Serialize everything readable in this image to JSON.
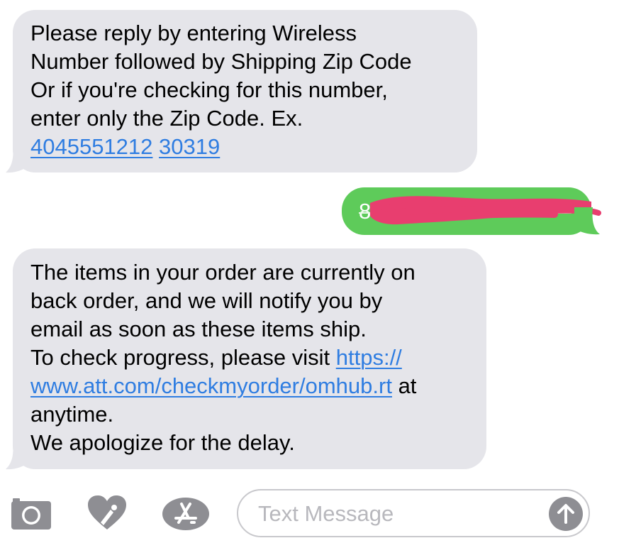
{
  "thread": {
    "messages": [
      {
        "direction": "incoming",
        "lines": [
          "Please reply by entering Wireless",
          "Number followed by Shipping Zip Code",
          "Or if you're checking for this number,",
          "enter only the Zip Code. Ex."
        ],
        "links": [
          "4045551212",
          "30319"
        ]
      },
      {
        "direction": "outgoing",
        "text_visible": "8",
        "redacted": true
      },
      {
        "direction": "incoming",
        "lines": [
          "The items in your order are currently on",
          "back order, and we will notify you by",
          "email as soon as these items ship.",
          "To check progress, please visit "
        ],
        "link_part1": "https://",
        "link_part2": "www.att.com/checkmyorder/omhub.rt",
        "after_link": " at",
        "line_anytime": "anytime.",
        "line_apology": "We apologize for the delay."
      }
    ]
  },
  "composer": {
    "camera_icon": "camera-icon",
    "digital_touch_icon": "digital-touch-heart-icon",
    "app_store_icon": "app-store-icon",
    "placeholder": "Text Message",
    "send_icon": "send-arrow-icon"
  },
  "colors": {
    "incoming_bubble": "#e5e5ea",
    "outgoing_bubble": "#5ecb5a",
    "link": "#2f7de1",
    "redaction": "#e83e6f",
    "icon_gray": "#8e8e93"
  }
}
